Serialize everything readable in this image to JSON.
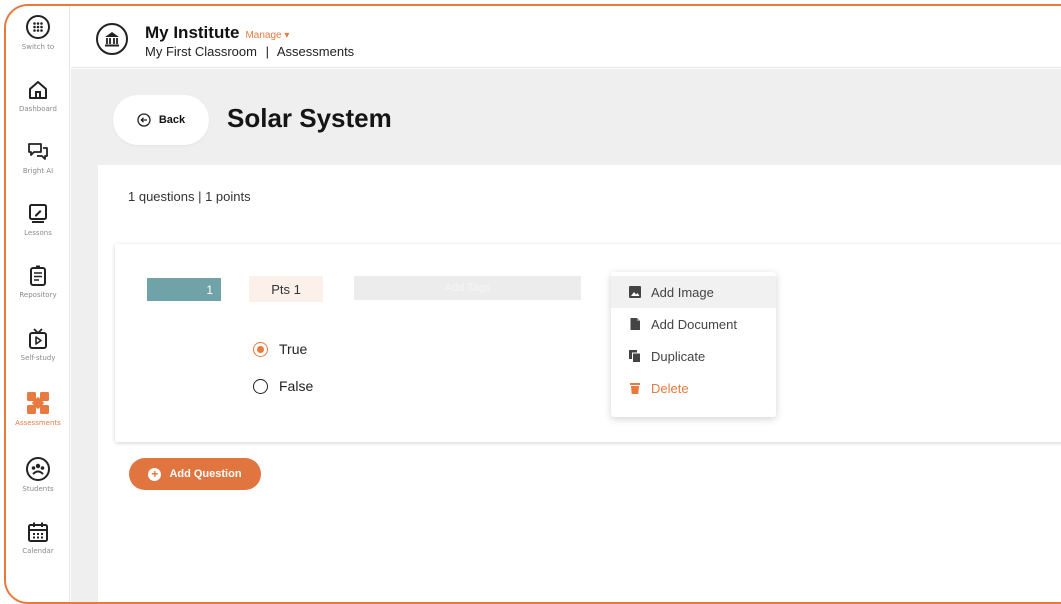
{
  "colors": {
    "accent": "#e8793f",
    "teal": "#6fa3a8"
  },
  "sidebar": {
    "items": [
      {
        "label": "Switch to",
        "icon": "grid-icon"
      },
      {
        "label": "Dashboard",
        "icon": "home-icon"
      },
      {
        "label": "Bright AI",
        "icon": "chat-icon"
      },
      {
        "label": "Lessons",
        "icon": "board-icon"
      },
      {
        "label": "Repository",
        "icon": "document-icon"
      },
      {
        "label": "Self-study",
        "icon": "tv-play-icon"
      },
      {
        "label": "Assessments",
        "icon": "puzzle-icon",
        "active": true
      },
      {
        "label": "Students",
        "icon": "group-icon"
      },
      {
        "label": "Calendar",
        "icon": "calendar-icon"
      }
    ]
  },
  "header": {
    "institute": "My Institute",
    "manage": "Manage",
    "classroom": "My First Classroom",
    "section": "Assessments"
  },
  "page": {
    "back_label": "Back",
    "title": "Solar System"
  },
  "quiz": {
    "summary": "1 questions | 1 points",
    "question": {
      "number": "1",
      "points": "Pts 1",
      "tag_placeholder": "Add Tags",
      "options": [
        {
          "label": "True",
          "selected": true
        },
        {
          "label": "False",
          "selected": false
        }
      ]
    },
    "menu": [
      {
        "label": "Add Image",
        "icon": "image-icon"
      },
      {
        "label": "Add Document",
        "icon": "file-icon"
      },
      {
        "label": "Duplicate",
        "icon": "copy-icon"
      },
      {
        "label": "Delete",
        "icon": "trash-icon"
      }
    ]
  },
  "actions": {
    "add_question": "Add Question"
  }
}
